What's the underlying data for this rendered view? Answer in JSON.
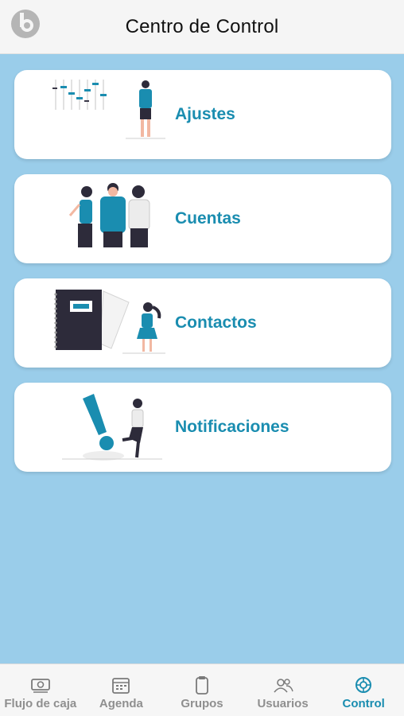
{
  "header": {
    "title": "Centro de Control",
    "logo_icon": "app-logo-icon"
  },
  "menu": [
    {
      "label": "Ajustes",
      "illustration": "settings-sliders-illustration"
    },
    {
      "label": "Cuentas",
      "illustration": "people-group-illustration"
    },
    {
      "label": "Contactos",
      "illustration": "notebook-person-illustration"
    },
    {
      "label": "Notificaciones",
      "illustration": "exclamation-person-illustration"
    }
  ],
  "tabbar": {
    "tabs": [
      {
        "label": "Flujo de caja",
        "icon": "cash-icon",
        "active": false
      },
      {
        "label": "Agenda",
        "icon": "calendar-icon",
        "active": false
      },
      {
        "label": "Grupos",
        "icon": "clipboard-icon",
        "active": false
      },
      {
        "label": "Usuarios",
        "icon": "users-icon",
        "active": false
      },
      {
        "label": "Control",
        "icon": "gear-icon",
        "active": true
      }
    ]
  },
  "colors": {
    "background": "#9acdea",
    "accent": "#1a8db0",
    "inactive": "#8f8f8f",
    "card": "#ffffff"
  }
}
